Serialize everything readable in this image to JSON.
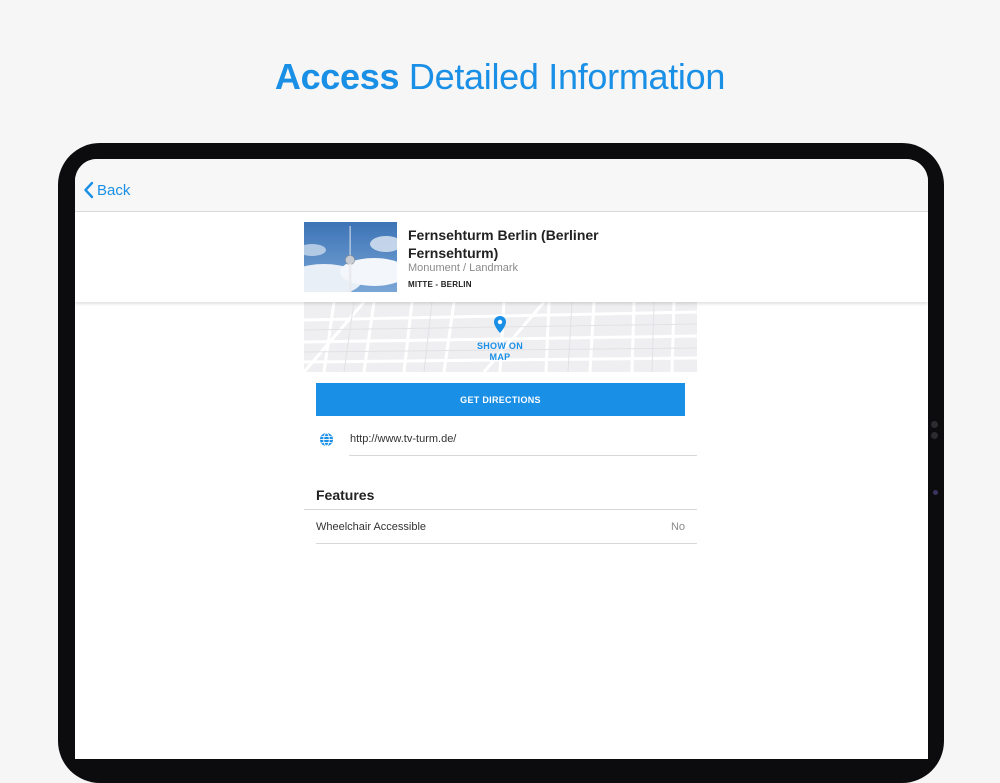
{
  "headline": {
    "strong": "Access",
    "rest": "Detailed Information"
  },
  "navbar": {
    "back_label": "Back"
  },
  "place": {
    "title": "Fernsehturm Berlin (Berliner Fernsehturm)",
    "type": "Monument / Landmark",
    "location": "MITTE - BERLIN"
  },
  "map": {
    "cta": "SHOW ON MAP",
    "icon": "map-pin-icon"
  },
  "directions": {
    "label": "GET DIRECTIONS"
  },
  "website": {
    "url": "http://www.tv-turm.de/",
    "icon": "globe-icon"
  },
  "features": {
    "title": "Features",
    "items": [
      {
        "label": "Wheelchair Accessible",
        "value": "No"
      }
    ]
  },
  "colors": {
    "accent": "#1a8fe6",
    "background": "#f6f6f7",
    "device": "#0c0c0e"
  }
}
